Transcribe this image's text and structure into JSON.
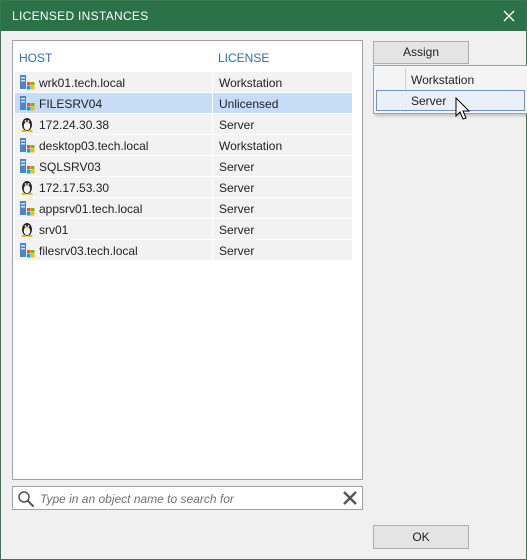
{
  "window": {
    "title": "LICENSED INSTANCES"
  },
  "table": {
    "columns": {
      "host": "HOST",
      "license": "LICENSE"
    },
    "rows": [
      {
        "host": "wrk01.tech.local",
        "license": "Workstation",
        "icon": "windows-server-icon"
      },
      {
        "host": "FILESRV04",
        "license": "Unlicensed",
        "icon": "windows-server-icon"
      },
      {
        "host": "172.24.30.38",
        "license": "Server",
        "icon": "linux-icon"
      },
      {
        "host": "desktop03.tech.local",
        "license": "Workstation",
        "icon": "windows-server-icon"
      },
      {
        "host": "SQLSRV03",
        "license": "Server",
        "icon": "windows-server-icon"
      },
      {
        "host": "172.17.53.30",
        "license": "Server",
        "icon": "linux-icon"
      },
      {
        "host": "appsrv01.tech.local",
        "license": "Server",
        "icon": "windows-server-icon"
      },
      {
        "host": "srv01",
        "license": "Server",
        "icon": "linux-icon"
      },
      {
        "host": "filesrv03.tech.local",
        "license": "Server",
        "icon": "windows-server-icon"
      }
    ]
  },
  "search": {
    "placeholder": "Type in an object name to search for"
  },
  "buttons": {
    "assign": "Assign",
    "ok": "OK"
  },
  "assign_menu": {
    "items": [
      "Workstation",
      "Server"
    ]
  },
  "colors": {
    "titlebar": "#2c7249",
    "header_text": "#2a6ebb",
    "selection": "#c6dcf7"
  }
}
